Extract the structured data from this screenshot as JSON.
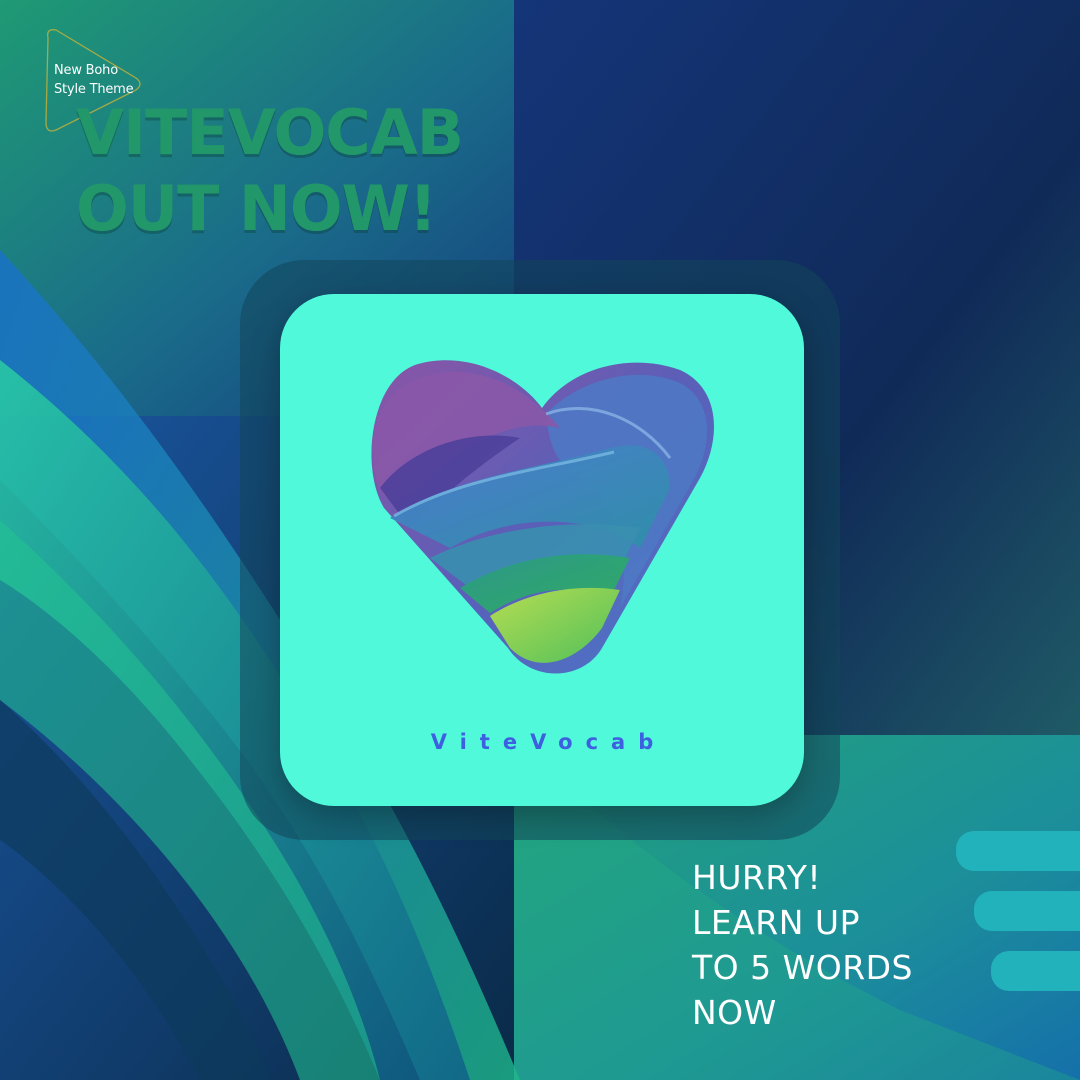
{
  "brand": {
    "line1": "New Boho",
    "line2": "Style Theme"
  },
  "headline": {
    "line1": "VITEVOCAB",
    "line2": "OUT NOW!"
  },
  "app": {
    "name": "ViteVocab",
    "logo_icon": "heart-v-logo-icon"
  },
  "promo": {
    "line1": "HURRY!",
    "line2": "LEARN UP",
    "line3": "TO 5 WORDS",
    "line4": "NOW"
  },
  "colors": {
    "headline": "#22986a",
    "tile": "#4ff9d9",
    "app_name": "#3d5fe0",
    "stripes": "#22b2bb",
    "promo_text": "#ffffff"
  }
}
